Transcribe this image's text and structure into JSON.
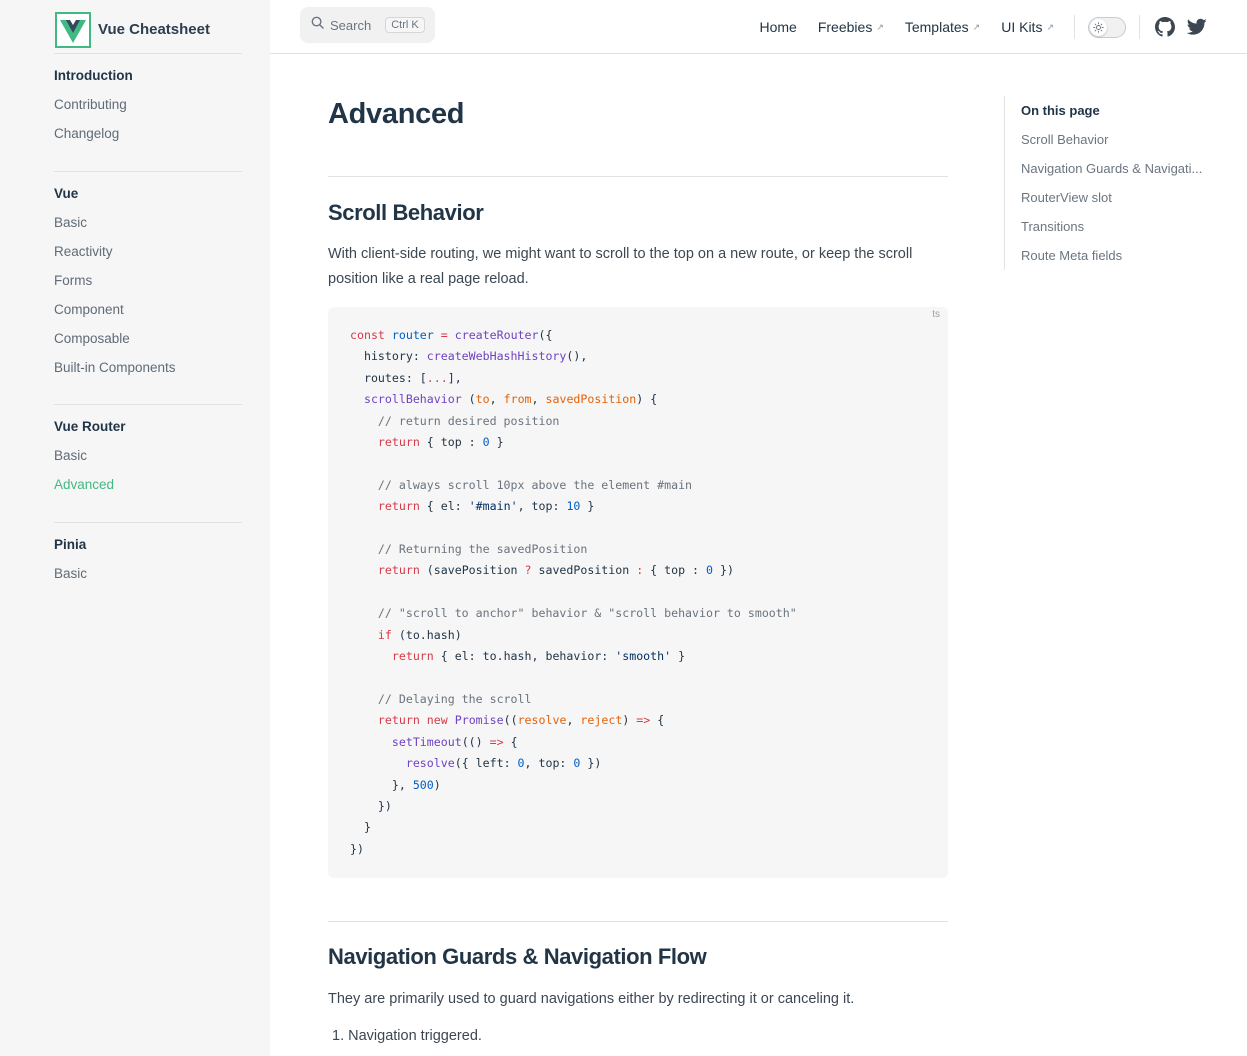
{
  "brand": {
    "title": "Vue Cheatsheet",
    "accent": "#42b883",
    "dark": "#35495e"
  },
  "sidebar": {
    "groups": [
      {
        "title": "Introduction",
        "items": [
          "Contributing",
          "Changelog"
        ]
      },
      {
        "title": "Vue",
        "items": [
          "Basic",
          "Reactivity",
          "Forms",
          "Component",
          "Composable",
          "Built-in Components"
        ]
      },
      {
        "title": "Vue Router",
        "items": [
          "Basic",
          "Advanced"
        ]
      },
      {
        "title": "Pinia",
        "items": [
          "Basic"
        ]
      }
    ],
    "active_item": "Advanced"
  },
  "search": {
    "label": "Search",
    "shortcut": "Ctrl K",
    "icon": "search-icon"
  },
  "topnav": {
    "home": "Home",
    "freebies": "Freebies",
    "templates": "Templates",
    "uikits": "UI Kits",
    "external_icon": "↗",
    "theme_toggle_icon": "sun-icon",
    "github_icon": "github-icon",
    "twitter_icon": "twitter-icon"
  },
  "page": {
    "title": "Advanced",
    "sections": {
      "scroll": {
        "heading": "Scroll Behavior",
        "text": "With client-side routing, we might want to scroll to the top on a new route, or keep the scroll position like a real page reload.",
        "code_lang": "ts"
      },
      "guards": {
        "heading": "Navigation Guards & Navigation Flow",
        "text": "They are primarily used to guard navigations either by redirecting it or canceling it.",
        "list": [
          "1. Navigation triggered."
        ]
      }
    }
  },
  "aside": {
    "title": "On this page",
    "links": [
      "Scroll Behavior",
      "Navigation Guards & Navigati...",
      "RouterView slot",
      "Transitions",
      "Route Meta fields"
    ]
  }
}
